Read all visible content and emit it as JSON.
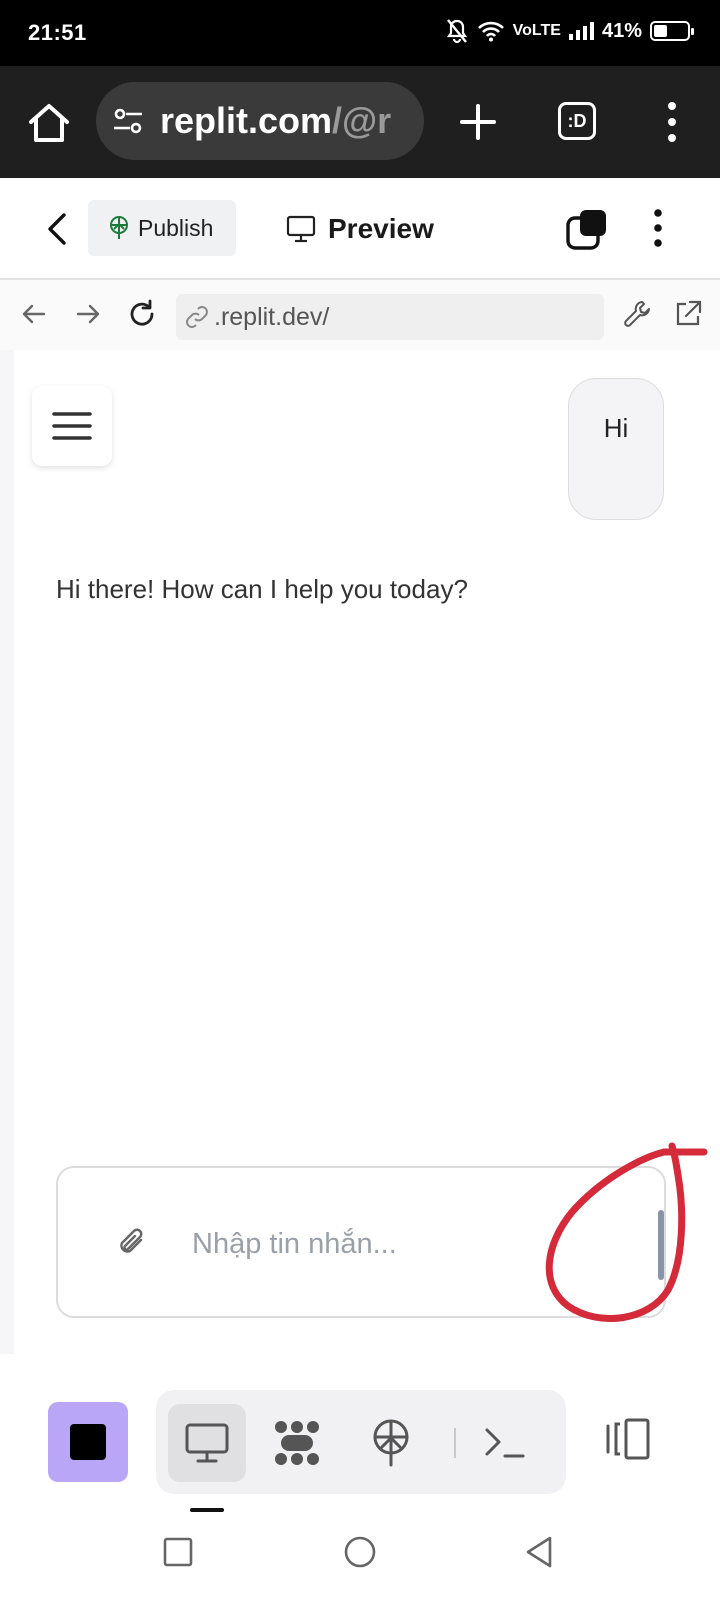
{
  "status_bar": {
    "time": "21:51",
    "network": "VoLTE",
    "battery": "41%",
    "battery_level": 0.41
  },
  "browser": {
    "url_host": "replit.com",
    "url_path": "/@r",
    "tabs_label": ":D",
    "icons": [
      "home-icon",
      "site-settings-icon",
      "plus-icon",
      "tabs-icon",
      "more-vertical-icon"
    ]
  },
  "app_toolbar": {
    "publish_label": "Publish",
    "preview_label": "Preview",
    "icons": [
      "back-chevron-icon",
      "publish-icon",
      "monitor-icon",
      "layers-icon",
      "more-vertical-icon"
    ]
  },
  "address_bar": {
    "url": ".replit.dev/",
    "icons": [
      "arrow-left-icon",
      "arrow-right-icon",
      "reload-icon",
      "link-icon",
      "wrench-icon",
      "external-link-icon"
    ]
  },
  "chat": {
    "user_message": "Hi",
    "bot_message": "Hi there! How can I help you today?",
    "input_placeholder": "Nhập tin nhắn...",
    "input_value": ""
  },
  "bottom_toolbar": {
    "tools": [
      "preview-icon",
      "workflow-icon",
      "deploy-icon",
      "terminal-icon"
    ],
    "active_tool": "preview-icon",
    "accent_color": "#b9a6f7"
  },
  "annotation_color": "#d42a3a"
}
